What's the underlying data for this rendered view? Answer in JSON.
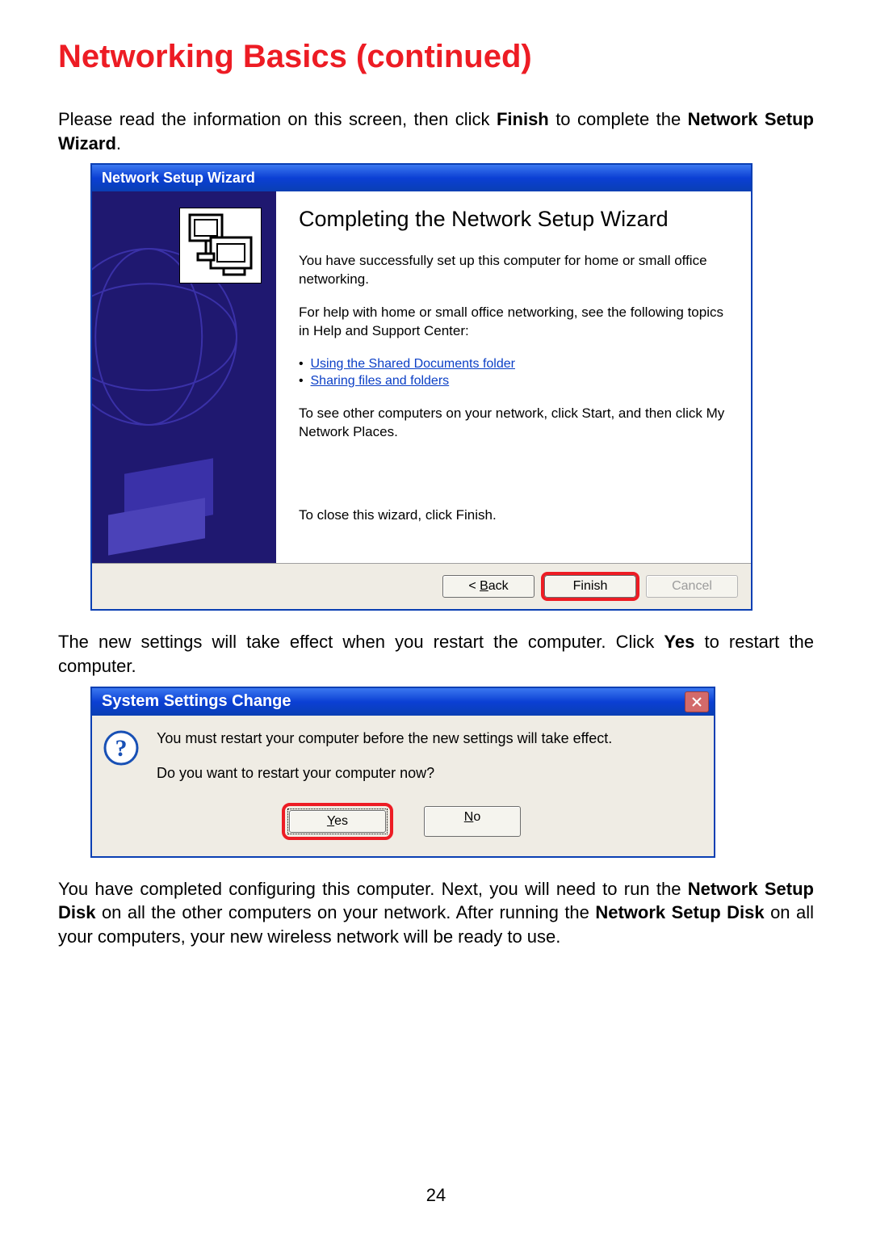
{
  "page": {
    "section_title": "Networking Basics (continued)",
    "intro_before": "Please read the information on this screen, then click ",
    "intro_bold1": "Finish",
    "intro_mid": " to complete the ",
    "intro_bold2": "Network Setup Wizard",
    "intro_after": ".",
    "page_number": "24"
  },
  "wizard": {
    "titlebar": "Network Setup Wizard",
    "heading": "Completing the Network Setup Wizard",
    "para1": "You have successfully set up this computer for home or small office networking.",
    "para2": "For help with home or small office networking, see the following topics in Help and Support Center:",
    "links": [
      "Using the Shared Documents folder",
      "Sharing files and folders"
    ],
    "para3": "To see other computers on your network, click Start, and then click My Network Places.",
    "para4": "To close this wizard, click Finish.",
    "btn_back_prefix": "< ",
    "btn_back_u": "B",
    "btn_back_suffix": "ack",
    "btn_finish": "Finish",
    "btn_cancel": "Cancel"
  },
  "after_wizard": {
    "before": "The new settings will take effect when you restart the computer. Click ",
    "bold": "Yes",
    "after": " to restart the computer."
  },
  "msgbox": {
    "title": "System Settings Change",
    "line1": "You must restart your computer before the new settings will take effect.",
    "line2": "Do you want to restart your computer now?",
    "yes_u": "Y",
    "yes_rest": "es",
    "no_u": "N",
    "no_rest": "o"
  },
  "closing": {
    "p1_before": "You have completed configuring this computer. Next, you will need to run the ",
    "p1_bold1": "Network Setup Disk",
    "p1_mid": " on all the other computers on your network.  After running the ",
    "p1_bold2": "Network Setup Disk",
    "p1_after": " on all your computers, your new wireless network will be ready to use."
  }
}
